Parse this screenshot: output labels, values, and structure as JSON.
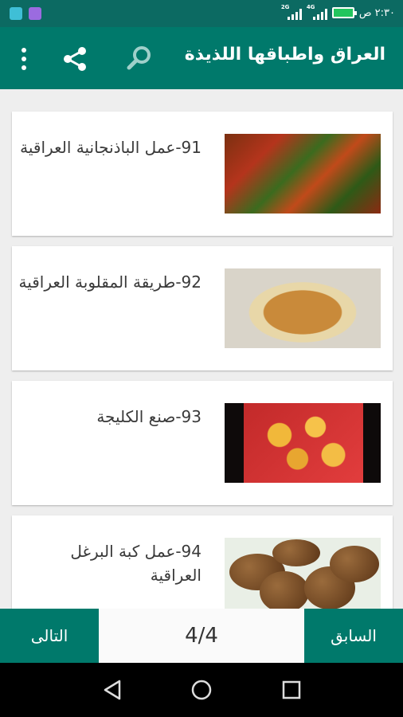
{
  "status_bar": {
    "time": "٢:٣٠ ص",
    "network_1": "2G",
    "network_2": "4G"
  },
  "app_bar": {
    "title": "العراق واطباقها اللذيذة",
    "icons": [
      "search-icon",
      "share-icon",
      "more-vert-icon"
    ]
  },
  "recipes": [
    {
      "title": "91-عمل الباذنجانية العراقية",
      "thumb": "eggplant-dish"
    },
    {
      "title": "92-طريقة المقلوبة العراقية",
      "thumb": "maqluba-dish"
    },
    {
      "title": "93-صنع الكليجة",
      "thumb": "kleicha-cookies"
    },
    {
      "title": "94-عمل كبة البرغل العراقية",
      "thumb": "kubba-dish"
    }
  ],
  "pager": {
    "next_label": "التالى",
    "page_indicator": "4/4",
    "prev_label": "السابق"
  },
  "colors": {
    "primary": "#00796b",
    "status_bar": "#0c6a62",
    "card_bg": "#ffffff",
    "list_bg": "#eeeeee"
  }
}
